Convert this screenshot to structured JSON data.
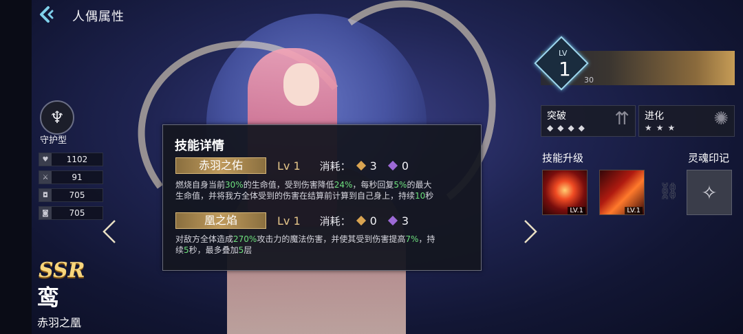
{
  "header": {
    "title": "人偶属性"
  },
  "character": {
    "role": "守护型",
    "rarity": "SSR",
    "symbol": "鸾",
    "name": "赤羽之凰"
  },
  "stats": [
    {
      "icon": "heart-icon",
      "value": "1102"
    },
    {
      "icon": "sword-icon",
      "value": "91"
    },
    {
      "icon": "shield-icon",
      "value": "705"
    },
    {
      "icon": "magic-shield-icon",
      "value": "705"
    }
  ],
  "skill_panel": {
    "title": "技能详情",
    "cost_label": "消耗：",
    "skills": [
      {
        "name": "赤羽之佑",
        "level": "Lv 1",
        "cost_gold": "3",
        "cost_purple": "0",
        "desc": [
          {
            "t": "燃烧自身当前"
          },
          {
            "t": "30%",
            "hl": true
          },
          {
            "t": "的生命值，受到伤害降低"
          },
          {
            "t": "24%",
            "hl": true
          },
          {
            "t": "，每秒回复"
          },
          {
            "t": "5%",
            "hl": true
          },
          {
            "t": "的最大生命值，并将我方全体受到的伤害在结算前计算到自己身上，持续"
          },
          {
            "t": "10",
            "hl": true
          },
          {
            "t": "秒"
          }
        ]
      },
      {
        "name": "凰之焰",
        "level": "Lv 1",
        "cost_gold": "0",
        "cost_purple": "3",
        "desc": [
          {
            "t": "对敌方全体造成"
          },
          {
            "t": "270%",
            "hl": true
          },
          {
            "t": "攻击力的魔法伤害，并使其受到伤害提高"
          },
          {
            "t": "7%",
            "hl": true
          },
          {
            "t": "，持续"
          },
          {
            "t": "5",
            "hl": true
          },
          {
            "t": "秒，最多叠加"
          },
          {
            "t": "5",
            "hl": true
          },
          {
            "t": "层"
          }
        ]
      }
    ]
  },
  "level": {
    "label": "LV",
    "value": "1",
    "max": "30"
  },
  "breakthrough": {
    "label": "突破",
    "stars": "◆◆◆◆"
  },
  "evolution": {
    "label": "进化",
    "stars": "★★★"
  },
  "skill_upgrade": {
    "label": "技能升级",
    "slots": [
      {
        "level": "LV.1"
      },
      {
        "level": "LV.1"
      }
    ]
  },
  "soul_mark": {
    "label": "灵魂印记"
  },
  "colors": {
    "highlight": "#6ee07e",
    "gold": "#d9a451",
    "purple": "#9d6ad6",
    "accent": "#9fd8ef"
  }
}
